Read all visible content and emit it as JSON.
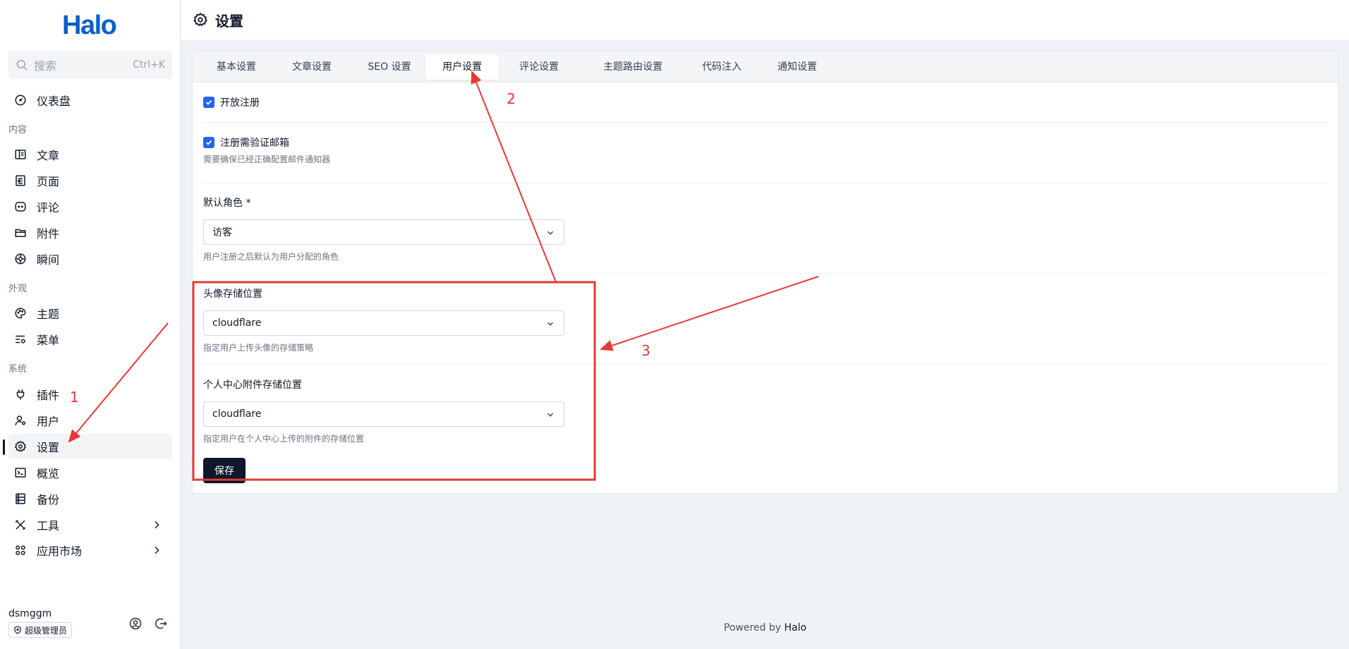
{
  "sidebar": {
    "logo": "Halo",
    "search": {
      "placeholder": "搜索",
      "shortcut": "Ctrl+K"
    },
    "items": [
      {
        "label": "仪表盘",
        "icon": "dashboard-icon"
      },
      {
        "label": "文章",
        "icon": "book-icon"
      },
      {
        "label": "页面",
        "icon": "page-icon"
      },
      {
        "label": "评论",
        "icon": "comment-icon"
      },
      {
        "label": "附件",
        "icon": "folder-icon"
      },
      {
        "label": "瞬间",
        "icon": "moments-icon"
      },
      {
        "label": "主题",
        "icon": "palette-icon"
      },
      {
        "label": "菜单",
        "icon": "menu-settings-icon"
      },
      {
        "label": "插件",
        "icon": "plug-icon"
      },
      {
        "label": "用户",
        "icon": "user-icon"
      },
      {
        "label": "设置",
        "icon": "gear-icon"
      },
      {
        "label": "概览",
        "icon": "terminal-icon"
      },
      {
        "label": "备份",
        "icon": "backup-icon"
      },
      {
        "label": "工具",
        "icon": "tools-icon"
      },
      {
        "label": "应用市场",
        "icon": "apps-icon"
      }
    ],
    "groups": {
      "content": "内容",
      "appearance": "外观",
      "system": "系统"
    },
    "user": {
      "name": "dsmggm",
      "role": "超级管理员"
    }
  },
  "header": {
    "title": "设置",
    "icon": "gear-icon"
  },
  "tabs": [
    "基本设置",
    "文章设置",
    "SEO 设置",
    "用户设置",
    "评论设置",
    "主题路由设置",
    "代码注入",
    "通知设置"
  ],
  "active_tab": "用户设置",
  "form": {
    "allow_register": {
      "label": "开放注册",
      "checked": true
    },
    "require_email": {
      "label": "注册需验证邮箱",
      "checked": true,
      "help": "需要确保已经正确配置邮件通知器"
    },
    "default_role": {
      "label": "默认角色 *",
      "value": "访客",
      "help": "用户注册之后默认为用户分配的角色"
    },
    "avatar_storage": {
      "label": "头像存储位置",
      "value": "cloudflare",
      "help": "指定用户上传头像的存储策略"
    },
    "uc_attachment_storage": {
      "label": "个人中心附件存储位置",
      "value": "cloudflare",
      "help": "指定用户在个人中心上传的附件的存储位置"
    },
    "save_label": "保存"
  },
  "footer": {
    "prefix": "Powered by",
    "brand": "Halo"
  },
  "annotations": {
    "numbers": [
      "1",
      "2",
      "3"
    ],
    "color": "#e53935"
  },
  "colors": {
    "accent": "#2563eb",
    "brand": "#0e5ec9",
    "primary_button": "#0f172a"
  }
}
